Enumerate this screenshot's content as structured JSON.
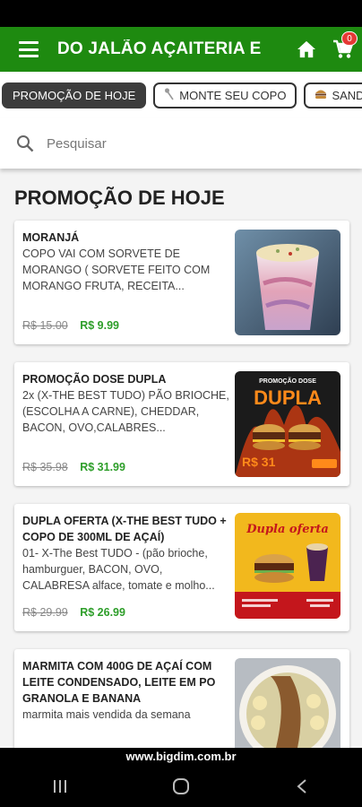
{
  "header": {
    "title": "DO JALÃO AÇAITERIA E",
    "cart_count": "0"
  },
  "categories": [
    {
      "label": "PROMOÇÃO DE HOJE",
      "icon": "",
      "active": true
    },
    {
      "label": "MONTE SEU COPO",
      "icon": "spoon-icon",
      "active": false
    },
    {
      "label": "SAND",
      "icon": "burger-icon",
      "active": false
    }
  ],
  "search": {
    "placeholder": "Pesquisar"
  },
  "section": {
    "title": "PROMOÇÃO DE HOJE"
  },
  "products": [
    {
      "name": "MORANJÁ",
      "description": "COPO VAI COM SORVETE DE MORANGO ( SORVETE FEITO COM MORANGO FRUTA, RECEITA...",
      "old_price": "R$ 15.00",
      "price": "R$ 9.99"
    },
    {
      "name": "PROMOÇÃO DOSE DUPLA",
      "description": "2x (X-THE BEST TUDO) PÃO BRIOCHE, (ESCOLHA A CARNE), CHEDDAR, BACON, OVO,CALABRES...",
      "old_price": "R$ 35.98",
      "price": "R$ 31.99",
      "image_text": {
        "line1": "PROMOÇÃO DOSE",
        "line2": "DUPLA",
        "price": "R$ 31"
      }
    },
    {
      "name": "DUPLA OFERTA (X-THE BEST TUDO + COPO DE 300ML DE AÇAÍ)",
      "description": "01- X-The Best TUDO - (pão brioche, hamburguer, BACON, OVO, CALABRESA alface, tomate e molho...",
      "old_price": "R$ 29.99",
      "price": "R$ 26.99",
      "image_text": {
        "title": "Dupla oferta"
      }
    },
    {
      "name": "MARMITA COM 400G DE AÇAÍ COM LEITE CONDENSADO, LEITE EM PO GRANOLA E BANANA",
      "description": "marmita mais vendida da semana"
    }
  ],
  "footer": {
    "website": "www.bigdim.com.br"
  },
  "colors": {
    "header_green": "#1e8a10",
    "price_green": "#2e9e2a",
    "badge_red": "#e53935"
  }
}
